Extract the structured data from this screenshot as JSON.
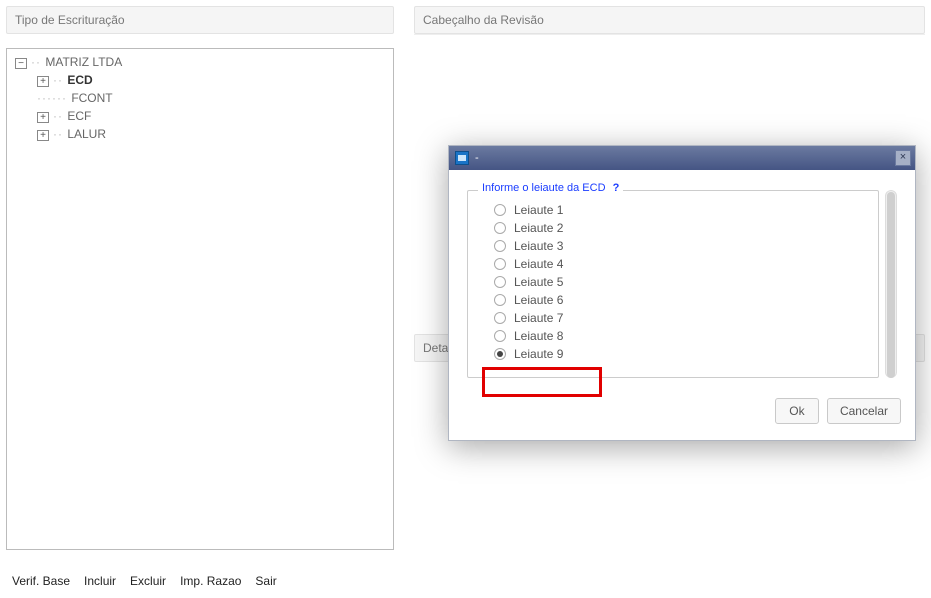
{
  "left_panel": {
    "title": "Tipo de Escrituração",
    "tree": {
      "root": "MATRIZ LTDA",
      "children": [
        {
          "label": "ECD",
          "expandable": true,
          "selected": true
        },
        {
          "label": "FCONT",
          "expandable": false
        },
        {
          "label": "ECF",
          "expandable": true
        },
        {
          "label": "LALUR",
          "expandable": true
        }
      ]
    }
  },
  "toolbar": {
    "verif": "Verif. Base",
    "incluir": "Incluir",
    "excluir": "Excluir",
    "imp_razao": "Imp. Razao",
    "sair": "Sair"
  },
  "right_panel": {
    "header_title": "Cabeçalho da Revisão",
    "detalhe_title": "Detal"
  },
  "modal": {
    "title": "-",
    "legend": "Informe o leiaute da ECD",
    "help": "?",
    "options": [
      {
        "label": "Leiaute 1",
        "checked": false
      },
      {
        "label": "Leiaute 2",
        "checked": false
      },
      {
        "label": "Leiaute 3",
        "checked": false
      },
      {
        "label": "Leiaute 4",
        "checked": false
      },
      {
        "label": "Leiaute 5",
        "checked": false
      },
      {
        "label": "Leiaute 6",
        "checked": false
      },
      {
        "label": "Leiaute 7",
        "checked": false
      },
      {
        "label": "Leiaute 8",
        "checked": false
      },
      {
        "label": "Leiaute 9",
        "checked": true
      }
    ],
    "ok": "Ok",
    "cancel": "Cancelar"
  }
}
